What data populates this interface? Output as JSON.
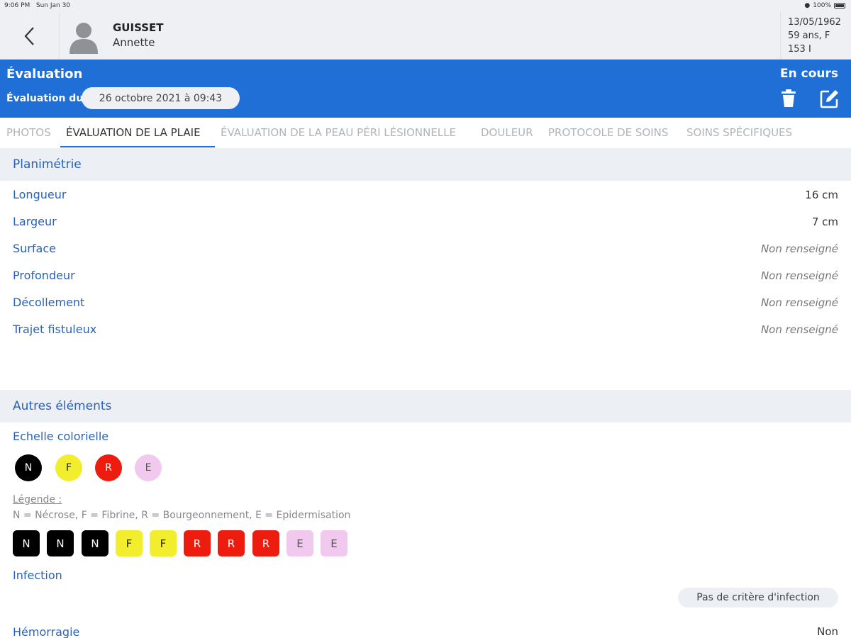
{
  "status_bar": {
    "time": "9:06 PM",
    "date": "Sun Jan 30",
    "battery": "100%"
  },
  "patient": {
    "last_name": "GUISSET",
    "first_name": "Annette",
    "birth_date": "13/05/1962",
    "age_sex": "59 ans, F",
    "room": "153 I"
  },
  "evaluation": {
    "title": "Évaluation",
    "date_label": "Évaluation du",
    "date_value": "26 octobre 2021 à 09:43",
    "status": "En cours"
  },
  "tabs": [
    {
      "label": "PHOTOS"
    },
    {
      "label": "ÉVALUATION DE LA PLAIE"
    },
    {
      "label": "ÉVALUATION DE LA PEAU PÉRI LÉSIONNELLE"
    },
    {
      "label": "DOULEUR"
    },
    {
      "label": "PROTOCOLE DE SOINS"
    },
    {
      "label": "SOINS SPÉCIFIQUES"
    }
  ],
  "planimetrie": {
    "header": "Planimétrie",
    "rows": [
      {
        "label": "Longueur",
        "value": "16 cm"
      },
      {
        "label": "Largeur",
        "value": "7 cm"
      },
      {
        "label": "Surface",
        "value": "Non renseigné"
      },
      {
        "label": "Profondeur",
        "value": "Non renseigné"
      },
      {
        "label": "Décollement",
        "value": "Non renseigné"
      },
      {
        "label": "Trajet fistuleux",
        "value": "Non renseigné"
      }
    ]
  },
  "autres": {
    "header": "Autres éléments",
    "echelle_label": "Echelle colorielle",
    "circles": [
      {
        "letter": "N",
        "color": "#000000",
        "text_color": "#ffffff"
      },
      {
        "letter": "F",
        "color": "#f2ee2e",
        "text_color": "#222222"
      },
      {
        "letter": "R",
        "color": "#ee1c0e",
        "text_color": "#ffffff"
      },
      {
        "letter": "E",
        "color": "#f2c9ee",
        "text_color": "#555555"
      }
    ],
    "legend_title": "Légende :",
    "legend_text": "N = Nécrose, F = Fibrine, R = Bourgeonnement, E = Epidermisation",
    "squares": [
      "N",
      "N",
      "N",
      "F",
      "F",
      "R",
      "R",
      "R",
      "E",
      "E"
    ],
    "infection_label": "Infection",
    "infection_value": "Pas de critère d'infection",
    "hemorragie_label": "Hémorragie",
    "hemorragie_value": "Non"
  },
  "colors": {
    "accent": "#1f6fd6",
    "label_blue": "#2a62b6",
    "section_bg": "#eceff3"
  }
}
